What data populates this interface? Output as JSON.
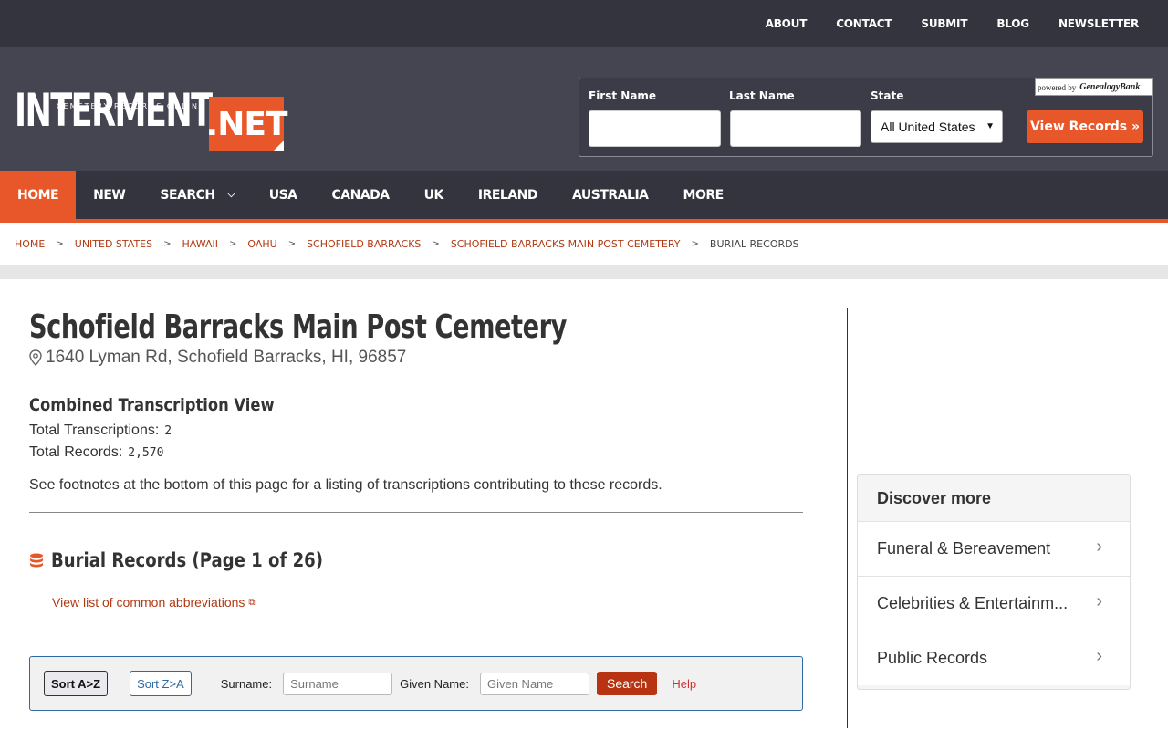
{
  "topnav": [
    "ABOUT",
    "CONTACT",
    "SUBMIT",
    "BLOG",
    "NEWSLETTER"
  ],
  "logo": {
    "main": "INTERMENT",
    "suffix": ".NET",
    "tagline": "CEMETERY RECORDS ONLINE"
  },
  "search": {
    "first_label": "First Name",
    "last_label": "Last Name",
    "state_label": "State",
    "state_value": "All United States",
    "button": "View Records »",
    "powered_by": "powered by",
    "partner": "GenealogyBank"
  },
  "mainnav": {
    "home": "HOME",
    "new": "NEW",
    "search": "SEARCH",
    "usa": "USA",
    "canada": "CANADA",
    "uk": "UK",
    "ireland": "IRELAND",
    "australia": "AUSTRALIA",
    "more": "MORE"
  },
  "breadcrumb": [
    "HOME",
    "UNITED STATES",
    "HAWAII",
    "OAHU",
    "SCHOFIELD BARRACKS",
    "SCHOFIELD BARRACKS MAIN POST CEMETERY",
    "BURIAL RECORDS"
  ],
  "page": {
    "title": "Schofield Barracks Main Post Cemetery",
    "address": "1640 Lyman Rd, Schofield Barracks, HI, 96857",
    "subtitle": "Combined Transcription View",
    "transcriptions_label": "Total Transcriptions:",
    "transcriptions_value": "2",
    "records_label": "Total Records:",
    "records_value": "2,570",
    "footnote": "See footnotes at the bottom of this page for a listing of transcriptions contributing to these records.",
    "burial_heading": "Burial Records (Page 1 of 26)",
    "abbr_link": "View list of common abbreviations"
  },
  "filter": {
    "sort_az": "Sort A>Z",
    "sort_za": "Sort Z>A",
    "surname_label": "Surname:",
    "surname_placeholder": "Surname",
    "given_label": "Given Name:",
    "given_placeholder": "Given Name",
    "search": "Search",
    "help": "Help"
  },
  "discover": {
    "heading": "Discover more",
    "items": [
      "Funeral & Bereavement",
      "Celebrities & Entertainm...",
      "Public Records"
    ]
  },
  "colors": {
    "accent": "#e8572a",
    "dark": "#34343f",
    "link": "#b13a14"
  }
}
